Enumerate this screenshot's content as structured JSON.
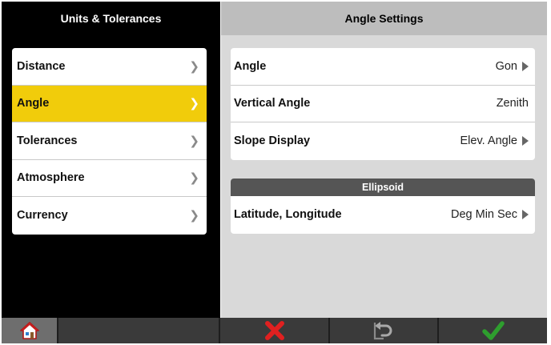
{
  "left_panel": {
    "title": "Units & Tolerances",
    "items": [
      {
        "label": "Distance",
        "selected": false
      },
      {
        "label": "Angle",
        "selected": true
      },
      {
        "label": "Tolerances",
        "selected": false
      },
      {
        "label": "Atmosphere",
        "selected": false
      },
      {
        "label": "Currency",
        "selected": false
      }
    ],
    "chevron_glyph": "❯"
  },
  "right_panel": {
    "title": "Angle Settings",
    "settings": [
      {
        "label": "Angle",
        "value": "Gon",
        "has_arrow": true
      },
      {
        "label": "Vertical Angle",
        "value": "Zenith",
        "has_arrow": false
      },
      {
        "label": "Slope Display",
        "value": "Elev. Angle",
        "has_arrow": true
      }
    ],
    "ellipsoid": {
      "heading": "Ellipsoid",
      "settings": [
        {
          "label": "Latitude, Longitude",
          "value": "Deg Min Sec",
          "has_arrow": true
        }
      ]
    }
  },
  "toolbar": {
    "buttons": [
      {
        "name": "home-button",
        "icon": "home-icon"
      },
      {
        "name": "cancel-button",
        "icon": "x-icon",
        "color": "#e02020"
      },
      {
        "name": "undo-button",
        "icon": "undo-icon"
      },
      {
        "name": "confirm-button",
        "icon": "checkmark-icon",
        "color": "#2e9e2e"
      }
    ]
  },
  "colors": {
    "selected_item": "#f1cc0b",
    "left_background": "#000000",
    "right_background": "#d9d9d9",
    "right_header": "#bdbdbd",
    "section_header": "#555555"
  }
}
